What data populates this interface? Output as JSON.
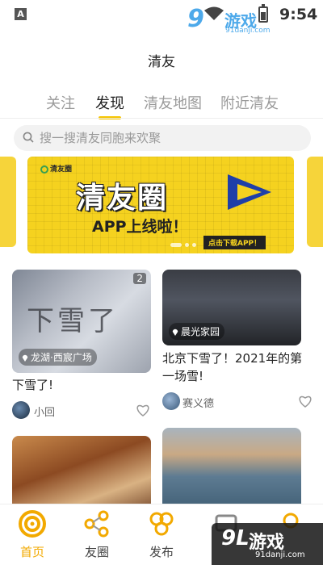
{
  "status_bar": {
    "time": "9:54",
    "indicator": "A"
  },
  "watermark": {
    "number": "9",
    "brand": "游戏",
    "url": "91danji.com",
    "bottom_number": "9L",
    "bottom_brand": "游戏"
  },
  "header": {
    "title": "清友"
  },
  "tabs": [
    {
      "label": "关注",
      "active": false
    },
    {
      "label": "发现",
      "active": true
    },
    {
      "label": "清友地图",
      "active": false
    },
    {
      "label": "附近清友",
      "active": false
    }
  ],
  "search": {
    "placeholder": "搜一搜清友同胞来欢聚"
  },
  "banner": {
    "logo": "清友圈",
    "headline": "清友圈",
    "subline": "APP上线啦！",
    "cta": "点击下载APP！",
    "background_color": "#f5d21f"
  },
  "feed": [
    {
      "title": "下雪了!",
      "location": "龙湖·西宸广场",
      "image_count": "2",
      "author": "小回",
      "image_icon": "snow-writing-photo"
    },
    {
      "title": "北京下雪了！2021年的第一场雪!",
      "location": "晨光家园",
      "image_count": "",
      "author": "赛义德",
      "image_icon": "station-photo"
    },
    {
      "title": "",
      "location": "",
      "author": "",
      "image_icon": "food-photo"
    },
    {
      "title": "",
      "location": "",
      "author": "",
      "image_icon": "seaside-photo"
    }
  ],
  "bottom_nav": [
    {
      "label": "首页",
      "icon": "home-swirl-icon",
      "active": true
    },
    {
      "label": "友圈",
      "icon": "share-swirl-icon",
      "active": false
    },
    {
      "label": "发布",
      "icon": "publish-swirl-icon",
      "active": false
    },
    {
      "label": "",
      "icon": "message-icon",
      "active": false
    },
    {
      "label": "",
      "icon": "profile-swirl-icon",
      "active": false
    }
  ],
  "colors": {
    "accent": "#f5c400",
    "active_nav": "#f2a900",
    "text_muted": "#9a9a9a"
  }
}
